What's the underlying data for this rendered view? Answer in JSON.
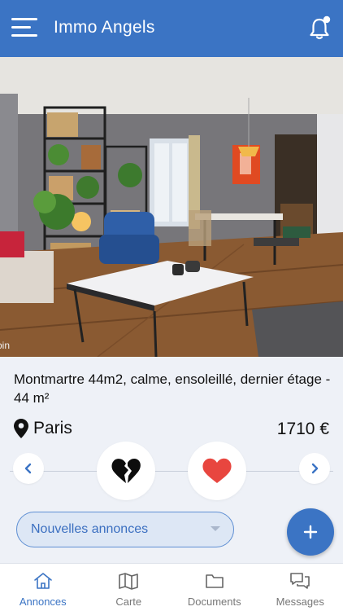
{
  "header": {
    "title": "Immo Angels"
  },
  "listing": {
    "title": "Montmartre 44m2, calme, ensoleillé, dernier étage - 44 m²",
    "city": "Paris",
    "price": "1710 €",
    "photo_edge_text": "oin"
  },
  "filter": {
    "selected": "Nouvelles annonces"
  },
  "tabs": [
    {
      "label": "Annonces",
      "icon": "home-icon",
      "active": true
    },
    {
      "label": "Carte",
      "icon": "map-icon",
      "active": false
    },
    {
      "label": "Documents",
      "icon": "folder-icon",
      "active": false
    },
    {
      "label": "Messages",
      "icon": "messages-icon",
      "active": false
    }
  ],
  "colors": {
    "primary": "#3b74c4",
    "like_red": "#e8463f",
    "background": "#eef1f7"
  }
}
